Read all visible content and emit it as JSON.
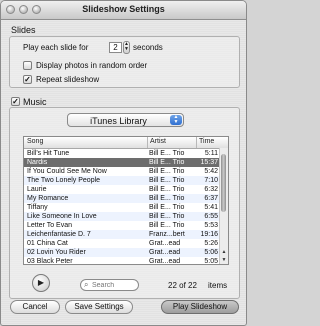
{
  "window": {
    "title": "Slideshow Settings"
  },
  "slides": {
    "section_label": "Slides",
    "play_each_prefix": "Play each slide for",
    "seconds_value": "2",
    "seconds_suffix": "seconds",
    "random_label": "Display photos in random order",
    "random_checked": false,
    "repeat_label": "Repeat slideshow",
    "repeat_checked": true
  },
  "music": {
    "label": "Music",
    "checked": true,
    "source_selected": "iTunes Library",
    "columns": {
      "song": "Song",
      "artist": "Artist",
      "time": "Time"
    },
    "tracks": [
      {
        "song": "Bill's Hit Tune",
        "artist": "Bill E... Trio",
        "time": "5:11"
      },
      {
        "song": "Nardis",
        "artist": "Bill E... Trio",
        "time": "15:37",
        "selected": true
      },
      {
        "song": "If You Could See Me Now",
        "artist": "Bill E... Trio",
        "time": "5:42"
      },
      {
        "song": "The Two Lonely People",
        "artist": "Bill E... Trio",
        "time": "7:10"
      },
      {
        "song": "Laurie",
        "artist": "Bill E... Trio",
        "time": "6:32"
      },
      {
        "song": "My Romance",
        "artist": "Bill E... Trio",
        "time": "6:37"
      },
      {
        "song": "Tiffany",
        "artist": "Bill E... Trio",
        "time": "5:41"
      },
      {
        "song": "Like Someone In Love",
        "artist": "Bill E... Trio",
        "time": "6:55"
      },
      {
        "song": "Letter To Evan",
        "artist": "Bill E... Trio",
        "time": "5:53"
      },
      {
        "song": "Leichenfantasie D. 7",
        "artist": "Franz...bert",
        "time": "19:16"
      },
      {
        "song": "01 China Cat",
        "artist": "Grat...ead",
        "time": "5:26"
      },
      {
        "song": "02 Lovin You Rider",
        "artist": "Grat...ead",
        "time": "5:06"
      },
      {
        "song": "03 Black Peter",
        "artist": "Grat...ead",
        "time": "5:05"
      }
    ],
    "search_placeholder": "Search",
    "count_text": "22 of 22",
    "items_label": "items"
  },
  "buttons": {
    "cancel": "Cancel",
    "save": "Save Settings",
    "play": "Play Slideshow"
  }
}
